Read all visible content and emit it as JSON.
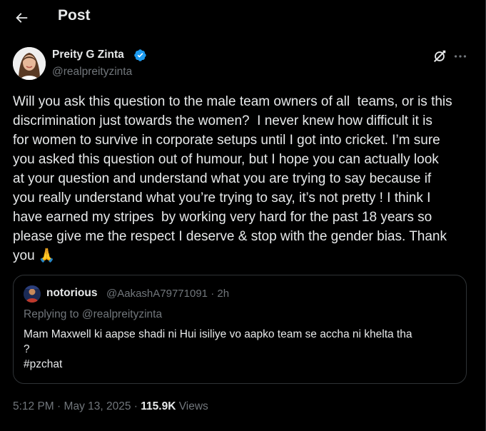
{
  "header": {
    "title": "Post"
  },
  "author": {
    "name": "Preity G Zinta",
    "handle": "@realpreityzinta"
  },
  "tweet": {
    "text": "Will you ask this question to the male team owners of all  teams, or is this\ndiscrimination just towards the women?  I never knew how difficult it is\nfor women to survive in corporate setups until I got into cricket. I’m sure\nyou asked this question out of humour, but I hope you can actually look\nat your question and understand what you are trying to say because if\nyou really understand what you’re trying to say, it’s not pretty ! I think I\nhave earned my stripes  by working very hard for the past 18 years so\nplease give me the respect I deserve & stop with the gender bias. Thank\nyou 🙏"
  },
  "quote": {
    "name": "notorious",
    "handle": "@AakashA79771091",
    "separator": "·",
    "time": "2h",
    "replying_prefix": "Replying to ",
    "replying_to": "@realpreityzinta",
    "text": "Mam Maxwell ki aapse shadi ni Hui isiliye vo aapko team se accha ni khelta tha\n?\n#pzchat"
  },
  "meta": {
    "time": "5:12 PM",
    "separator1": "·",
    "date": "May 13, 2025",
    "separator2": "·",
    "views_count": "115.9K",
    "views_label": "Views"
  },
  "colors": {
    "background": "#000000",
    "text": "#e7e9ea",
    "secondary": "#71767b",
    "border": "#2f3336",
    "verified": "#1d9bf0"
  },
  "icons": {
    "back": "arrow-left-icon",
    "verified": "verified-badge-icon",
    "grok": "grok-icon",
    "more": "more-horizontal-icon"
  }
}
